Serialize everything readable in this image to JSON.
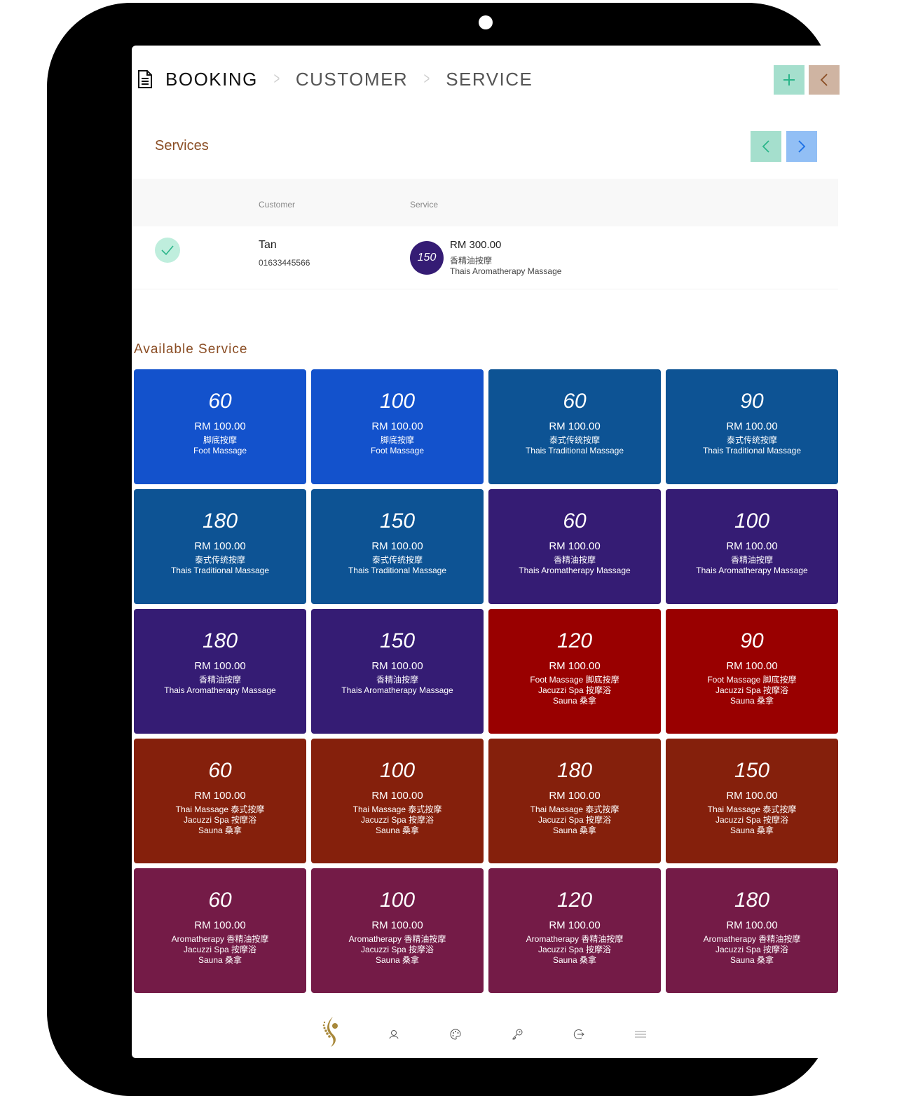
{
  "colors": {
    "accent_brown": "#8a4d24",
    "add_button": "#a5dfcd",
    "back_button": "#cfb4a2",
    "next_button": "#92bff5",
    "badge_purple": "#351c74"
  },
  "header": {
    "icon": "document-icon",
    "breadcrumbs": [
      {
        "label": "BOOKING",
        "active": true
      },
      {
        "label": "CUSTOMER",
        "active": false
      },
      {
        "label": "SERVICE",
        "active": false
      }
    ],
    "add_button_icon": "plus-icon",
    "back_button_icon": "chevron-left-icon"
  },
  "services": {
    "title": "Services",
    "prev_icon": "chevron-left-icon",
    "next_icon": "chevron-right-icon",
    "columns": [
      "Customer",
      "Service"
    ],
    "rows": [
      {
        "status_icon": "check-icon",
        "customer_name": "Tan",
        "customer_phone": "01633445566",
        "service_duration": "150",
        "service_price": "RM 300.00",
        "service_name_cn": "香精油按摩",
        "service_name_en": "Thais Aromatherapy Massage"
      }
    ]
  },
  "available": {
    "title": "Available Service",
    "cards": [
      {
        "duration": "60",
        "price": "RM 100.00",
        "desc": "脚底按摩\nFoot Massage",
        "color": "#1352cc"
      },
      {
        "duration": "100",
        "price": "RM 100.00",
        "desc": "脚底按摩\nFoot Massage",
        "color": "#1352cc"
      },
      {
        "duration": "60",
        "price": "RM 100.00",
        "desc": "泰式传统按摩\nThais Traditional Massage",
        "color": "#0d5394"
      },
      {
        "duration": "90",
        "price": "RM 100.00",
        "desc": "泰式传统按摩\nThais Traditional Massage",
        "color": "#0d5394"
      },
      {
        "duration": "180",
        "price": "RM 100.00",
        "desc": "泰式传统按摩\nThais Traditional Massage",
        "color": "#0d5394"
      },
      {
        "duration": "150",
        "price": "RM 100.00",
        "desc": "泰式传统按摩\nThais Traditional Massage",
        "color": "#0d5394"
      },
      {
        "duration": "60",
        "price": "RM 100.00",
        "desc": "香精油按摩\nThais Aromatherapy Massage",
        "color": "#351c74"
      },
      {
        "duration": "100",
        "price": "RM 100.00",
        "desc": "香精油按摩\nThais Aromatherapy Massage",
        "color": "#351c74"
      },
      {
        "duration": "180",
        "price": "RM 100.00",
        "desc": "香精油按摩\nThais Aromatherapy Massage",
        "color": "#351c74"
      },
      {
        "duration": "150",
        "price": "RM 100.00",
        "desc": "香精油按摩\nThais Aromatherapy Massage",
        "color": "#351c74"
      },
      {
        "duration": "120",
        "price": "RM 100.00",
        "desc": "Foot Massage 脚底按摩\nJacuzzi Spa 按摩浴\nSauna 桑拿",
        "color": "#990000"
      },
      {
        "duration": "90",
        "price": "RM 100.00",
        "desc": "Foot Massage 脚底按摩\nJacuzzi Spa 按摩浴\nSauna 桑拿",
        "color": "#990000"
      },
      {
        "duration": "60",
        "price": "RM 100.00",
        "desc": "Thai Massage 泰式按摩\nJacuzzi Spa 按摩浴\nSauna 桑拿",
        "color": "#85200c"
      },
      {
        "duration": "100",
        "price": "RM 100.00",
        "desc": "Thai Massage 泰式按摩\nJacuzzi Spa 按摩浴\nSauna 桑拿",
        "color": "#85200c"
      },
      {
        "duration": "180",
        "price": "RM 100.00",
        "desc": "Thai Massage 泰式按摩\nJacuzzi Spa 按摩浴\nSauna 桑拿",
        "color": "#85200c"
      },
      {
        "duration": "150",
        "price": "RM 100.00",
        "desc": "Thai Massage 泰式按摩\nJacuzzi Spa 按摩浴\nSauna 桑拿",
        "color": "#85200c"
      },
      {
        "duration": "60",
        "price": "RM 100.00",
        "desc": "Aromatherapy 香精油按摩\nJacuzzi Spa 按摩浴\nSauna 桑拿",
        "color": "#741b47"
      },
      {
        "duration": "100",
        "price": "RM 100.00",
        "desc": "Aromatherapy 香精油按摩\nJacuzzi Spa 按摩浴\nSauna 桑拿",
        "color": "#741b47"
      },
      {
        "duration": "120",
        "price": "RM 100.00",
        "desc": "Aromatherapy 香精油按摩\nJacuzzi Spa 按摩浴\nSauna 桑拿",
        "color": "#741b47"
      },
      {
        "duration": "180",
        "price": "RM 100.00",
        "desc": "Aromatherapy 香精油按摩\nJacuzzi Spa 按摩浴\nSauna 桑拿",
        "color": "#741b47"
      }
    ]
  },
  "bottom_nav": {
    "items": [
      "spine-logo-icon",
      "user-icon",
      "palette-icon",
      "key-icon",
      "logout-icon",
      "menu-icon"
    ]
  }
}
